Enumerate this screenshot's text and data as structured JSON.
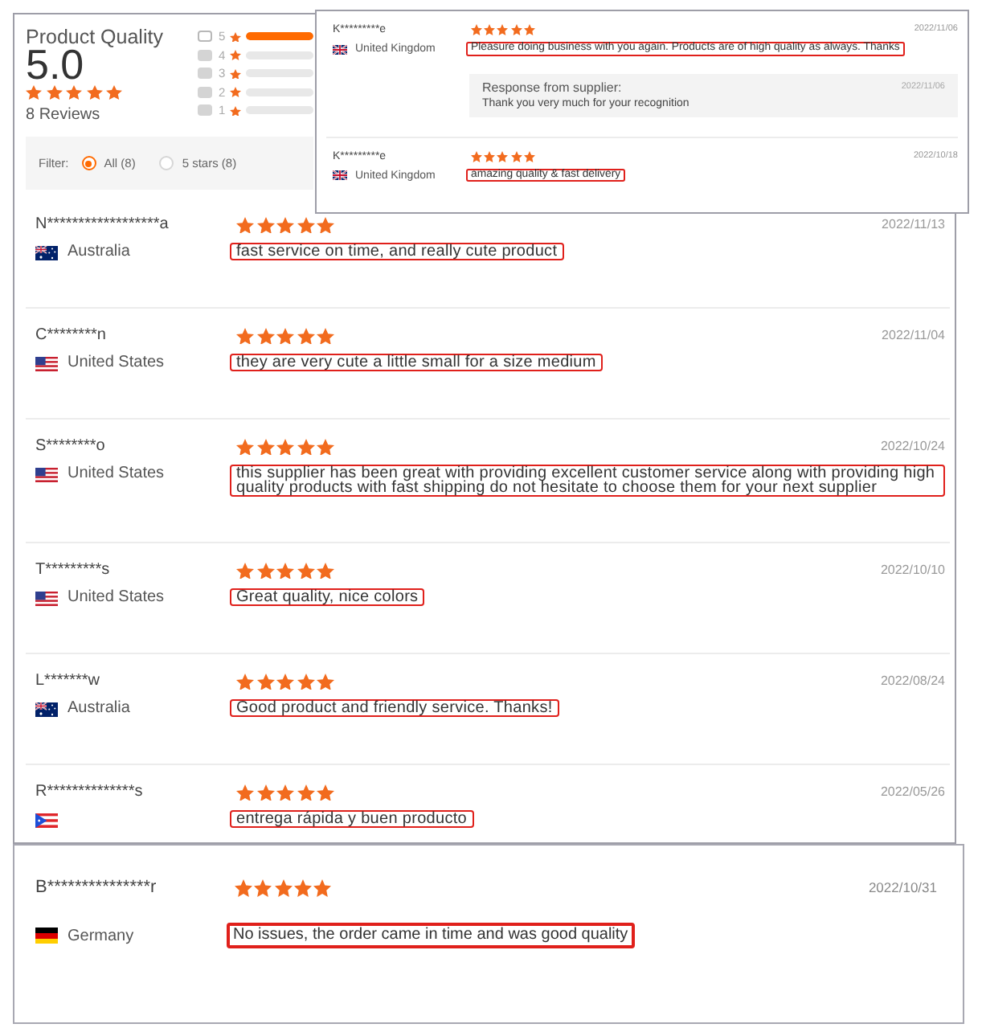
{
  "main_panel": {
    "summary": {
      "title": "Product Quality",
      "score": "5.0",
      "stars": 5,
      "count": "8 Reviews",
      "breakdown": [
        {
          "label": "5",
          "level": 1,
          "disabled": false
        },
        {
          "label": "4",
          "level": 0,
          "disabled": true
        },
        {
          "label": "3",
          "level": 0,
          "disabled": true
        },
        {
          "label": "2",
          "level": 0,
          "disabled": true
        },
        {
          "label": "1",
          "level": 0,
          "disabled": true
        }
      ]
    },
    "filter": {
      "label": "Filter:",
      "options": [
        {
          "label": "All (8)",
          "selected": true
        },
        {
          "label": "5 stars (8)",
          "selected": false
        }
      ]
    },
    "reviews": [
      {
        "name": "N******************a",
        "flag": {
          "kind": "au"
        },
        "country": "Australia",
        "stars": 5,
        "date": "2022/11/13",
        "text": "fast service on time, and really cute product",
        "highlighted": true
      },
      {
        "name": "C********n",
        "flag": {
          "kind": "us"
        },
        "country": "United States",
        "stars": 5,
        "date": "2022/11/04",
        "text": "they are very cute a little small for a size medium",
        "highlighted": true
      },
      {
        "name": "S********o",
        "flag": {
          "kind": "us"
        },
        "country": "United States",
        "stars": 5,
        "date": "2022/10/24",
        "text": "this supplier has been great with providing excellent customer service along with providing high quality products with fast shipping do not hesitate to choose them for your next supplier",
        "highlighted": true
      },
      {
        "name": "T*********s",
        "flag": {
          "kind": "us"
        },
        "country": "United States",
        "stars": 5,
        "date": "2022/10/10",
        "text": "Great quality, nice colors",
        "highlighted": true
      },
      {
        "name": "L*******w",
        "flag": {
          "kind": "au"
        },
        "country": "Australia",
        "stars": 5,
        "date": "2022/08/24",
        "text": "Good product and friendly service. Thanks!",
        "highlighted": true
      },
      {
        "name": "R**************s",
        "flag": {
          "kind": "pr"
        },
        "stars": 5,
        "date": "2022/05/26",
        "text": "entrega rápida y buen producto",
        "highlighted": true
      }
    ]
  },
  "inset_panel": {
    "reviews": [
      {
        "name": "K*********e",
        "flag": {
          "kind": "gb"
        },
        "country": "United Kingdom",
        "stars": 5,
        "date": "2022/11/06",
        "text": "Pleasure doing business with you again. Products are of high quality as always. Thanks",
        "highlighted": true,
        "response": {
          "title": "Response from supplier:",
          "date": "2022/11/06",
          "text": "Thank you very much for your recognition"
        }
      },
      {
        "name": "K*********e",
        "flag": {
          "kind": "gb"
        },
        "country": "United Kingdom",
        "stars": 5,
        "date": "2022/10/18",
        "text": "amazing quality & fast delivery",
        "highlighted": true
      }
    ]
  },
  "bottom_panel": {
    "reviews": [
      {
        "name": "B***************r",
        "flag": {
          "kind": "de"
        },
        "country": "Germany",
        "stars": 5,
        "date": "2022/10/31",
        "text": "No issues, the order came in time and was good quality",
        "highlighted": true
      }
    ]
  }
}
